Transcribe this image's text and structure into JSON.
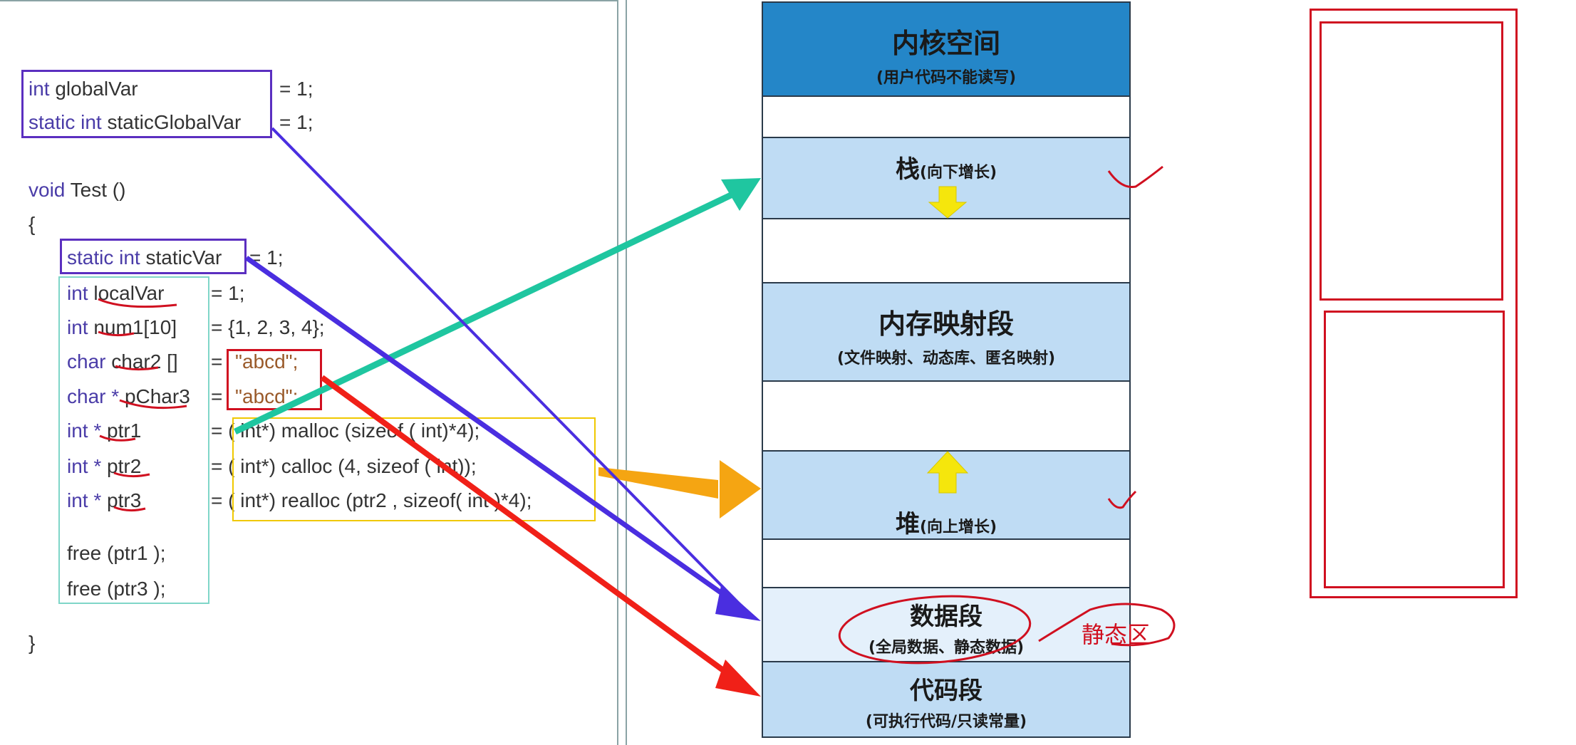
{
  "code": {
    "global_var": {
      "type": "int",
      "name": "globalVar",
      "value": "= 1;"
    },
    "static_global_var": {
      "kw": "static int",
      "name": "staticGlobalVar",
      "value": "= 1;"
    },
    "func_sig": {
      "kw": "void",
      "name": "Test ()"
    },
    "open_brace": "{",
    "close_brace": "}",
    "static_var": {
      "kw": "static int",
      "name": "staticVar",
      "value": "= 1;"
    },
    "local_var": {
      "kw": "int",
      "name": "localVar",
      "value": "= 1;"
    },
    "num1": {
      "kw": "int",
      "name": "num1[10]",
      "value": "= {1, 2, 3, 4};"
    },
    "char2": {
      "kw": "char",
      "name": "char2 []",
      "eq": "=",
      "str": "\"abcd\";"
    },
    "pchar3": {
      "kw": "char *",
      "name": "pChar3",
      "eq": "=",
      "str": "\"abcd\";"
    },
    "ptr1": {
      "kw": "int *",
      "name": "ptr1",
      "value": "= ( int*) malloc (sizeof ( int)*4);"
    },
    "ptr2": {
      "kw": "int *",
      "name": "ptr2",
      "value": "= ( int*) calloc (4, sizeof ( int));"
    },
    "ptr3": {
      "kw": "int *",
      "name": "ptr3",
      "value": "= ( int*) realloc (ptr2 , sizeof( int )*4);"
    },
    "free1": "free (ptr1 );",
    "free3": "free (ptr3 );"
  },
  "memory": {
    "kernel": {
      "title": "内核空间",
      "sub": "(用户代码不能读写)"
    },
    "stack": {
      "title": "栈",
      "sub": "(向下增长)"
    },
    "mmap": {
      "title": "内存映射段",
      "sub": "(文件映射、动态库、匿名映射)"
    },
    "heap": {
      "title": "堆",
      "sub": "(向上增长)"
    },
    "data": {
      "title": "数据段",
      "sub": "(全局数据、静态数据)"
    },
    "code_seg": {
      "title": "代码段",
      "sub": "(可执行代码/只读常量)"
    }
  },
  "annotations": {
    "static_area": "静态区"
  },
  "colors": {
    "kernel_blue": "#2486c8",
    "segment_blue": "#bfdcf4",
    "stack_arrow": "#1fc6a0",
    "heap_arrow": "#f5a512",
    "data_arrow": "#4a2ee0",
    "code_arrow": "#f02018",
    "grow_arrow": "#f5e60c"
  }
}
